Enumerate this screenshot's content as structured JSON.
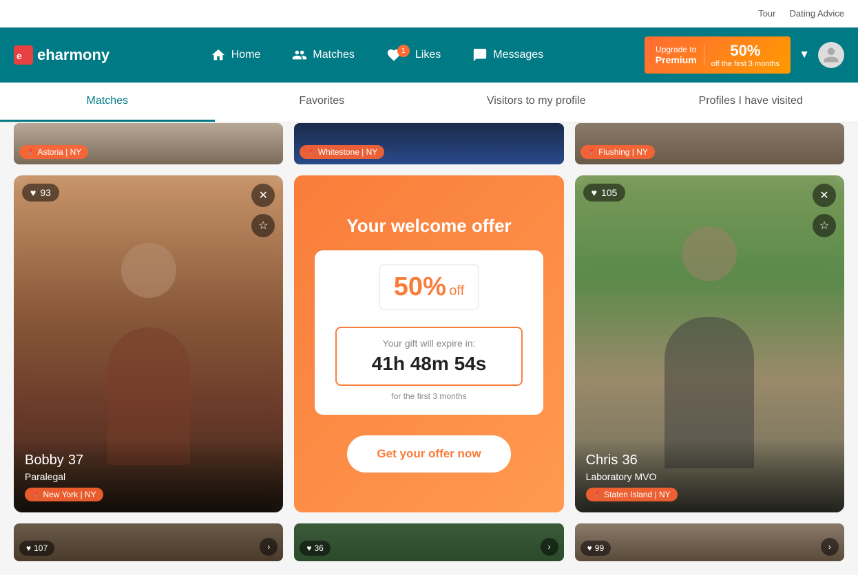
{
  "topBar": {
    "links": [
      "Tour",
      "Dating Advice"
    ]
  },
  "nav": {
    "logo": "eharmony",
    "links": [
      {
        "label": "Home",
        "icon": "home"
      },
      {
        "label": "Matches",
        "icon": "matches"
      },
      {
        "label": "Likes",
        "icon": "likes",
        "badge": "1"
      },
      {
        "label": "Messages",
        "icon": "messages"
      }
    ],
    "upgrade": {
      "line1": "Upgrade to",
      "line2": "Premium",
      "percent": "50%",
      "sub": "off the first 3 months"
    }
  },
  "tabs": [
    {
      "label": "Matches",
      "active": true
    },
    {
      "label": "Favorites",
      "active": false
    },
    {
      "label": "Visitors to my profile",
      "active": false
    },
    {
      "label": "Profiles I have visited",
      "active": false
    }
  ],
  "partialCards": [
    {
      "location": "Astoria | NY",
      "class": "card-astoria"
    },
    {
      "location": "Whitestone | NY",
      "class": "card-whitestone"
    },
    {
      "location": "Flushing | NY",
      "class": "card-flushing"
    }
  ],
  "profileCards": [
    {
      "type": "profile",
      "name": "Bobby",
      "age": "37",
      "profession": "Paralegal",
      "location": "New York | NY",
      "hearts": "93",
      "photoClass": "bobby"
    },
    {
      "type": "offer",
      "title": "Your welcome offer",
      "percent": "50%",
      "off": "off",
      "expireText": "Your gift will expire in:",
      "hours": "41h",
      "mins": "48m",
      "secs": "54s",
      "months": "for the first 3 months",
      "cta": "Get your offer now"
    },
    {
      "type": "profile",
      "name": "Chris",
      "age": "36",
      "profession": "Laboratory MVO",
      "location": "Staten Island | NY",
      "hearts": "105",
      "photoClass": "chris"
    }
  ],
  "bottomCards": [
    {
      "hearts": "107",
      "class": "bpc1"
    },
    {
      "hearts": "36",
      "class": "bpc2"
    },
    {
      "hearts": "99",
      "class": "bpc3"
    }
  ]
}
